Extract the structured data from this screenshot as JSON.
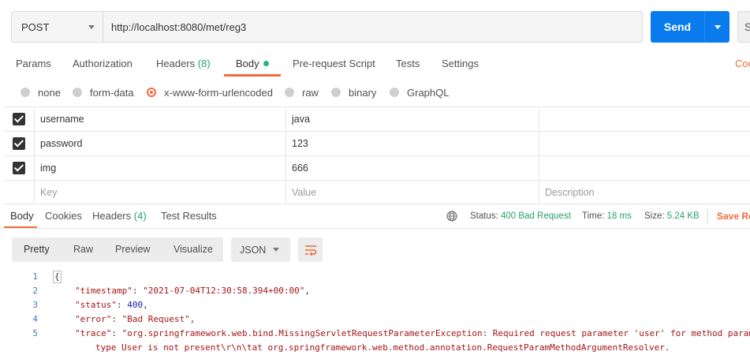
{
  "request": {
    "method": "POST",
    "url": "http://localhost:8080/met/reg3",
    "send_label": "Send",
    "save_partial": "S"
  },
  "request_tabs": [
    {
      "label": "Params"
    },
    {
      "label": "Authorization"
    },
    {
      "label": "Headers",
      "count": "(8)"
    },
    {
      "label": "Body"
    },
    {
      "label": "Pre-request Script"
    },
    {
      "label": "Tests"
    },
    {
      "label": "Settings"
    }
  ],
  "cookies_link": "Coo",
  "body_types": [
    {
      "label": "none"
    },
    {
      "label": "form-data"
    },
    {
      "label": "x-www-form-urlencoded"
    },
    {
      "label": "raw"
    },
    {
      "label": "binary"
    },
    {
      "label": "GraphQL"
    }
  ],
  "params": {
    "rows": [
      {
        "key": "username",
        "value": "java",
        "description": ""
      },
      {
        "key": "password",
        "value": "123",
        "description": ""
      },
      {
        "key": "img",
        "value": "666",
        "description": ""
      }
    ],
    "placeholders": {
      "key": "Key",
      "value": "Value",
      "description": "Description"
    }
  },
  "response_tabs": [
    {
      "label": "Body"
    },
    {
      "label": "Cookies"
    },
    {
      "label": "Headers",
      "count": "(4)"
    },
    {
      "label": "Test Results"
    }
  ],
  "response_meta": {
    "status_label": "Status:",
    "status_value": "400 Bad Request",
    "time_label": "Time:",
    "time_value": "18 ms",
    "size_label": "Size:",
    "size_value": "5.24 KB",
    "save_response": "Save Re"
  },
  "view_modes": [
    "Pretty",
    "Raw",
    "Preview",
    "Visualize"
  ],
  "format": "JSON",
  "code_lines": [
    {
      "num": "1",
      "text": "{"
    },
    {
      "num": "2",
      "key": "\"timestamp\"",
      "value": "\"2021-07-04T12:30:58.394+00:00\"",
      "tail": ","
    },
    {
      "num": "3",
      "key": "\"status\"",
      "value": "400",
      "tail": ","
    },
    {
      "num": "4",
      "key": "\"error\"",
      "value": "\"Bad Request\"",
      "tail": ","
    },
    {
      "num": "5",
      "key": "\"trace\"",
      "value": "\"org.springframework.web.bind.MissingServletRequestParameterException: Required request parameter 'user' for method param"
    },
    {
      "num": "",
      "text": "type User is not present\\r\\n\\tat org.springframework.web.method.annotation.RequestParamMethodArgumentResolver."
    }
  ]
}
